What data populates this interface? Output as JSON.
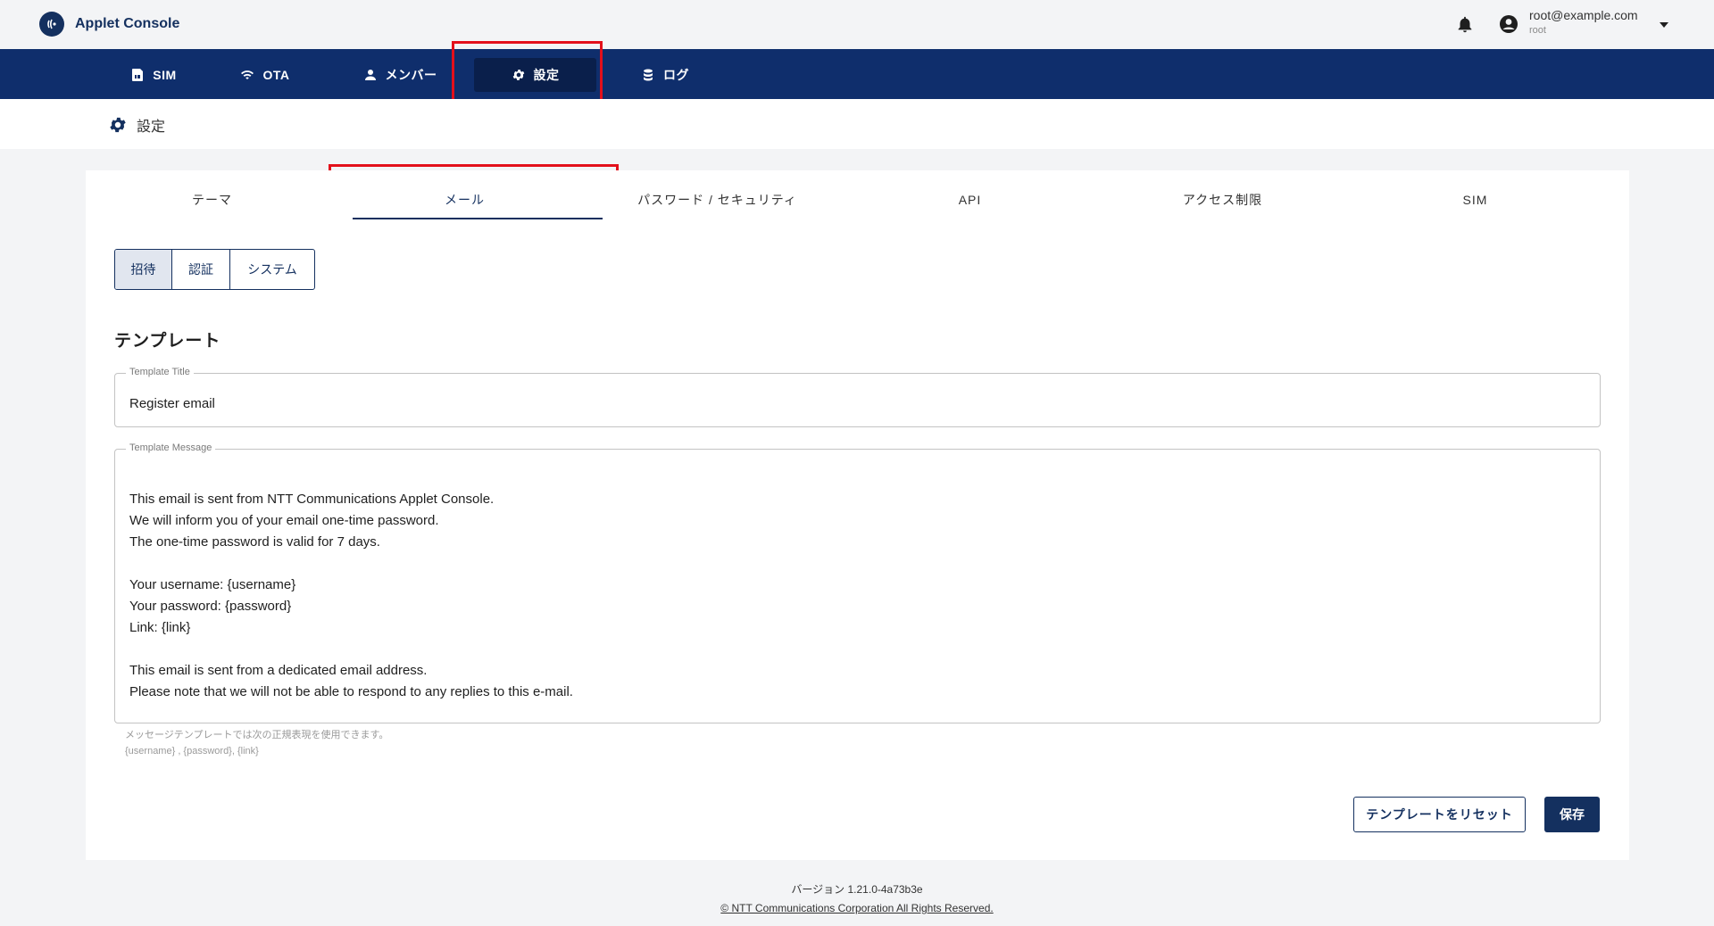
{
  "app": {
    "title": "Applet Console",
    "logo_icon": "nfc-logo-icon"
  },
  "account": {
    "email": "root@example.com",
    "username": "root"
  },
  "nav": {
    "items": [
      {
        "label": "SIM",
        "icon": "sim-card-icon"
      },
      {
        "label": "OTA",
        "icon": "wifi-icon"
      },
      {
        "label": "メンバー",
        "icon": "person-icon"
      },
      {
        "label": "設定",
        "icon": "gear-icon",
        "active": true
      },
      {
        "label": "ログ",
        "icon": "database-icon"
      }
    ]
  },
  "page": {
    "title": "設定"
  },
  "tabs": [
    {
      "label": "テーマ"
    },
    {
      "label": "メール",
      "active": true
    },
    {
      "label": "パスワード / セキュリティ"
    },
    {
      "label": "API"
    },
    {
      "label": "アクセス制限"
    },
    {
      "label": "SIM"
    }
  ],
  "subtabs": [
    {
      "label": "招待",
      "active": true
    },
    {
      "label": "認証"
    },
    {
      "label": "システム"
    }
  ],
  "template": {
    "section_title": "テンプレート",
    "title_label": "Template Title",
    "title_value": "Register email",
    "message_label": "Template Message",
    "message_lines": [
      "",
      "This email is sent from NTT Communications Applet Console.",
      "We will inform you of your email one-time password.",
      "The one-time password is valid for 7 days.",
      "",
      "Your username: {username}",
      "Your password: {password}",
      "Link: {link}",
      "",
      "This email is sent from a dedicated email address.",
      "Please note that we will not be able to respond to any replies to this e-mail."
    ],
    "helper_text": "メッセージテンプレートでは次の正規表現を使用できます。",
    "helper_vars": "{username} , {password}, {link}"
  },
  "buttons": {
    "reset": "テンプレートをリセット",
    "save": "保存"
  },
  "footer": {
    "version": "バージョン 1.21.0-4a73b3e",
    "copyright": "© NTT Communications Corporation All Rights Reserved."
  },
  "colors": {
    "brand": "#0f2e6c",
    "highlight": "#e3101b"
  }
}
